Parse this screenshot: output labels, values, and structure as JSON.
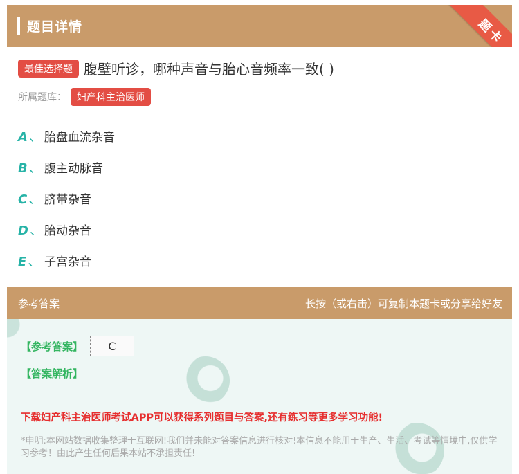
{
  "header": {
    "title": "题目详情",
    "ribbon": "题卡"
  },
  "question": {
    "type": "最佳选择题",
    "stem": "腹壁听诊，哪种声音与胎心音频率一致( )",
    "bank_label": "所属题库：",
    "bank": "妇产科主治医师"
  },
  "options": [
    {
      "letter": "A",
      "sep": "、",
      "text": "胎盘血流杂音"
    },
    {
      "letter": "B",
      "sep": "、",
      "text": "腹主动脉音"
    },
    {
      "letter": "C",
      "sep": "、",
      "text": "脐带杂音"
    },
    {
      "letter": "D",
      "sep": "、",
      "text": "胎动杂音"
    },
    {
      "letter": "E",
      "sep": "、",
      "text": "子宫杂音"
    }
  ],
  "answer": {
    "section_label": "参考答案",
    "share_hint": "长按（或右击）可复制本题卡或分享给好友",
    "answer_label": "【参考答案】",
    "answer_value": "C",
    "analysis_label": "【答案解析】",
    "promo": "下载妇产科主治医师考试APP可以获得系列题目与答案,还有练习等更多学习功能!",
    "disclaimer": "*申明:本网站数据收集整理于互联网!我们并未能对答案信息进行核对!本信息不能用于生产、生活、考试等情境中,仅供学习参考！由此产生任何后果本站不承担责任!"
  },
  "colors": {
    "header_bg": "#c99b6a",
    "badge_red": "#e34d44",
    "option_teal": "#27b3a7",
    "green": "#33b560",
    "promo_red": "#e62e2e",
    "answer_bg": "#eef7f5",
    "ribbon": "#e85a45"
  }
}
